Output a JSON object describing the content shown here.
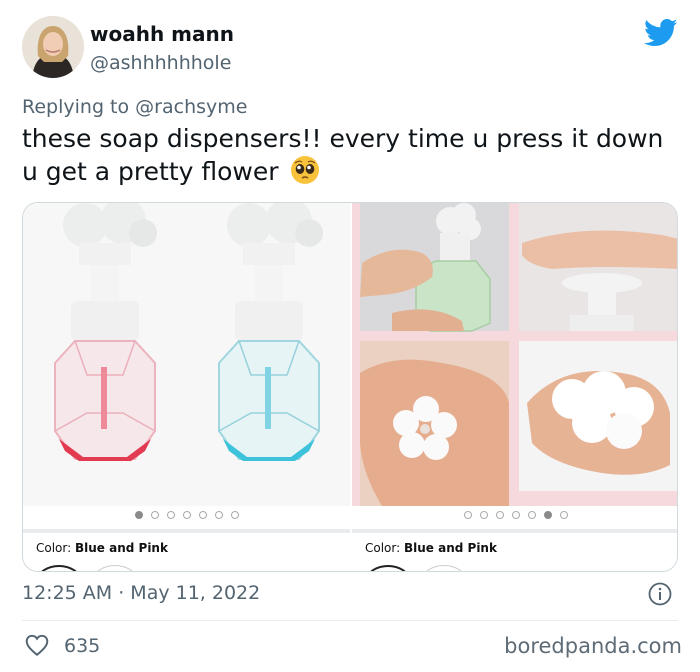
{
  "tweet": {
    "display_name": "woahh mann",
    "handle": "@ashhhhhhole",
    "reply_prefix": "Replying to",
    "reply_mention": "@rachsyme",
    "text": "these soap dispensers!! every time u press it down u get a pretty flower",
    "emoji_icon": "pleading-face-emoji",
    "timestamp": "12:25 AM · May 11, 2022",
    "like_count": "635"
  },
  "media": {
    "panels": [
      {
        "color_label_prefix": "Color:",
        "color_label_value": "Blue and Pink",
        "carousel_dots": 7,
        "active_dot": 1
      },
      {
        "color_label_prefix": "Color:",
        "color_label_value": "Blue and Pink",
        "carousel_dots": 7,
        "active_dot": 6
      }
    ]
  },
  "branding": {
    "watermark": "boredpanda.com",
    "twitter_icon": "twitter-bird-icon",
    "twitter_blue": "#1d9bf0"
  }
}
